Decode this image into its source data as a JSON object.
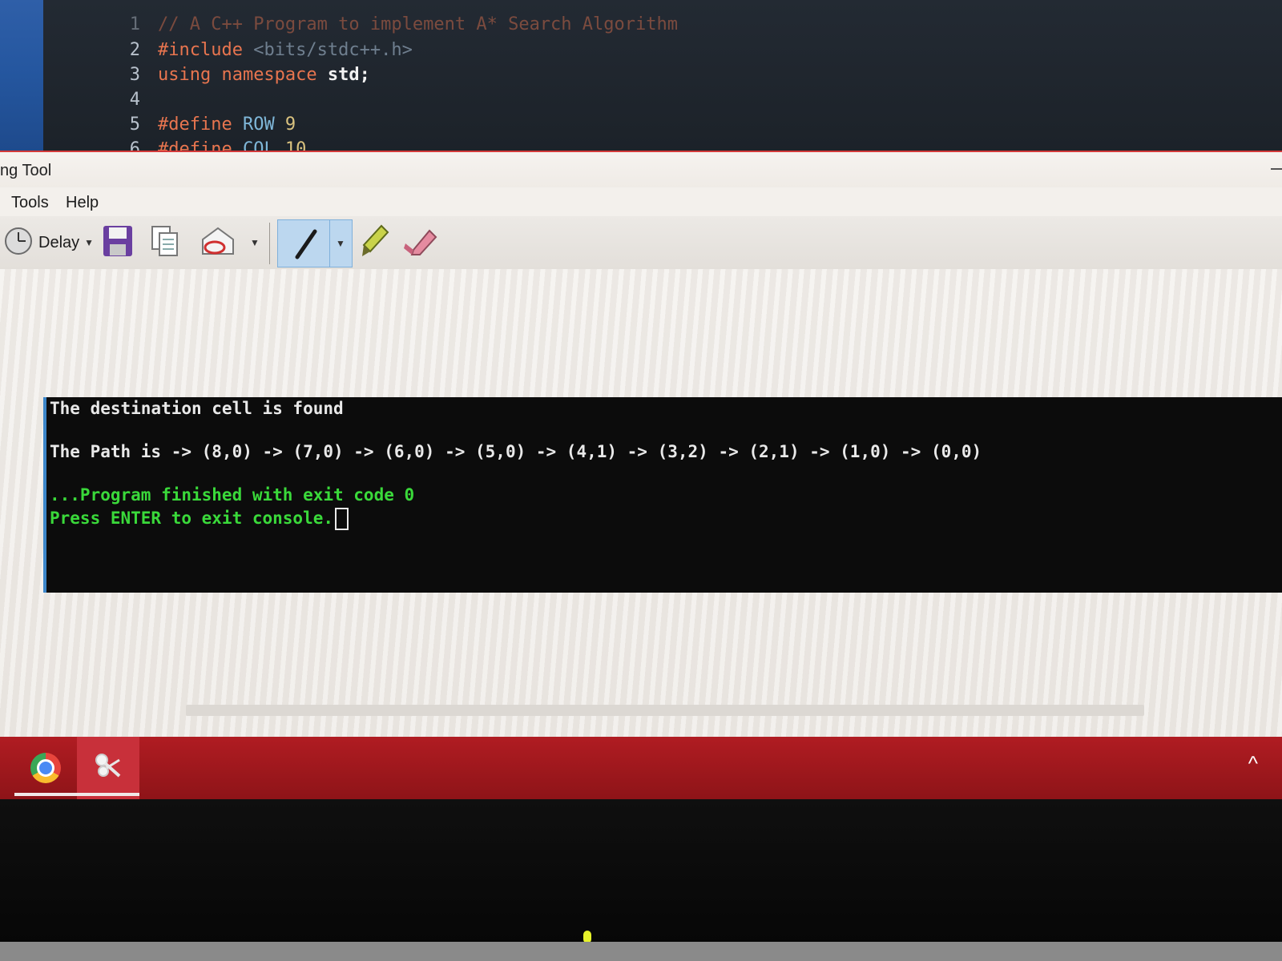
{
  "editor": {
    "lines": [
      {
        "num": "1",
        "text": "// A C++ Program to implement A* Search Algorithm"
      },
      {
        "num": "2",
        "kw": "#include",
        "rest": " <bits/stdc++.h>"
      },
      {
        "num": "3",
        "kw": "using namespace",
        "rest": " std;"
      },
      {
        "num": "4",
        "kw": "",
        "rest": ""
      },
      {
        "num": "5",
        "kw": "#define",
        "name": " ROW",
        "val": " 9"
      },
      {
        "num": "6",
        "kw": "#define",
        "name": " COL",
        "val": " 10"
      }
    ]
  },
  "snipping_tool": {
    "title": "ng Tool",
    "menu": [
      "Tools",
      "Help"
    ],
    "toolbar": {
      "delay_label": "Delay"
    }
  },
  "terminal": {
    "line1": "The destination cell is found",
    "line2": "The Path is -> (8,0) -> (7,0) -> (6,0) -> (5,0) -> (4,1) -> (3,2) -> (2,1) -> (1,0) -> (0,0)",
    "line3": "...Program finished with exit code 0",
    "line4": "Press ENTER to exit console."
  },
  "taskbar": {
    "apps": [
      "chrome",
      "snipping-tool"
    ],
    "tray_icon": "^"
  },
  "colors": {
    "taskbar": "#a81a20",
    "terminal_bg": "#0c0c0c",
    "terminal_green": "#3ad93a",
    "accent_blue": "#3c86c9"
  }
}
